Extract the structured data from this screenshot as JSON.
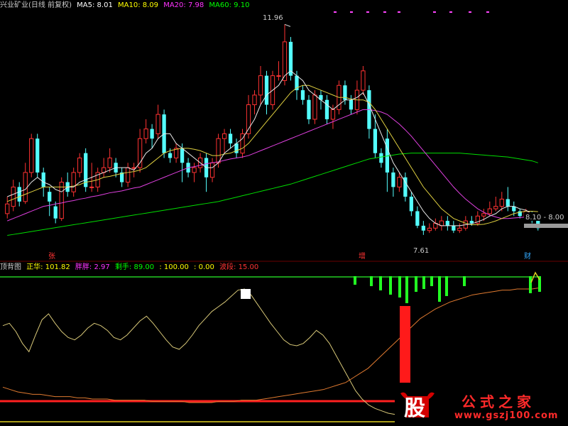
{
  "top_legend": [
    {
      "text": "兴业矿业(日线 前复权)",
      "color": "#cccccc"
    },
    {
      "text": "MA5: 8.01",
      "color": "#ffffff"
    },
    {
      "text": "MA10: 8.09",
      "color": "#ffff00"
    },
    {
      "text": "MA20: 7.98",
      "color": "#ff33ff"
    },
    {
      "text": "MA60: 9.10",
      "color": "#00ff00"
    }
  ],
  "bottom_legend": [
    {
      "text": "顶背图",
      "color": "#cccccc"
    },
    {
      "text": "正华: 101.82",
      "color": "#ffff00"
    },
    {
      "text": "胖胖: 2.97",
      "color": "#ff33ff"
    },
    {
      "text": "剩手: 89.00",
      "color": "#00ff00"
    },
    {
      "text": ": 100.00",
      "color": "#ffff00"
    },
    {
      "text": ": 0.00",
      "color": "#ffff00"
    },
    {
      "text": "波段: 15.00",
      "color": "#ff3333"
    }
  ],
  "watermark": {
    "logo_char": "股",
    "brand": "公式之家",
    "url": "www.gszj100.com"
  },
  "chart_data": [
    {
      "type": "candlestick",
      "title": "兴业矿业(日线 前复权)",
      "ylim": [
        7.3,
        12.2
      ],
      "annotations": {
        "high_label": "11.96",
        "low_label": "7.61",
        "price_tag": "8.10 - 8.00"
      },
      "markers": [
        "张",
        "增",
        "财"
      ],
      "candles": [
        [
          8.05,
          8.25,
          8.4,
          7.95
        ],
        [
          8.2,
          8.6,
          8.75,
          8.1
        ],
        [
          8.6,
          8.3,
          8.7,
          8.2
        ],
        [
          8.3,
          8.9,
          9.1,
          8.25
        ],
        [
          8.9,
          9.6,
          9.7,
          8.8
        ],
        [
          9.6,
          8.9,
          9.7,
          8.8
        ],
        [
          8.9,
          8.6,
          9.0,
          8.4
        ],
        [
          8.5,
          8.3,
          8.6,
          8.0
        ],
        [
          8.2,
          7.95,
          8.3,
          7.85
        ],
        [
          7.95,
          8.7,
          8.8,
          7.9
        ],
        [
          8.7,
          8.5,
          8.9,
          8.4
        ],
        [
          8.5,
          8.9,
          9.0,
          8.4
        ],
        [
          8.9,
          9.2,
          9.3,
          8.8
        ],
        [
          9.3,
          8.6,
          9.4,
          8.5
        ],
        [
          8.6,
          8.6,
          9.1,
          8.5
        ],
        [
          8.6,
          8.9,
          9.0,
          8.5
        ],
        [
          8.9,
          9.0,
          9.2,
          8.8
        ],
        [
          9.0,
          9.2,
          9.4,
          8.9
        ],
        [
          9.1,
          8.9,
          9.2,
          8.8
        ],
        [
          8.9,
          8.7,
          9.0,
          8.6
        ],
        [
          8.7,
          9.0,
          9.1,
          8.6
        ],
        [
          9.0,
          9.0,
          9.1,
          8.8
        ],
        [
          9.0,
          9.6,
          9.8,
          8.9
        ],
        [
          9.6,
          9.8,
          10.0,
          9.5
        ],
        [
          9.8,
          9.6,
          9.9,
          9.4
        ],
        [
          9.7,
          10.1,
          10.3,
          9.6
        ],
        [
          10.1,
          9.3,
          10.2,
          9.2
        ],
        [
          9.3,
          9.2,
          9.4,
          9.1
        ],
        [
          9.2,
          9.4,
          9.5,
          9.1
        ],
        [
          9.4,
          9.1,
          9.5,
          8.7
        ],
        [
          9.1,
          8.9,
          9.2,
          8.8
        ],
        [
          8.9,
          9.0,
          9.1,
          8.7
        ],
        [
          9.0,
          9.2,
          9.3,
          8.9
        ],
        [
          9.2,
          8.8,
          9.3,
          8.5
        ],
        [
          8.8,
          9.1,
          9.2,
          8.7
        ],
        [
          9.1,
          9.6,
          9.7,
          9.0
        ],
        [
          9.6,
          9.7,
          9.8,
          9.3
        ],
        [
          9.7,
          9.5,
          9.8,
          9.4
        ],
        [
          9.5,
          9.3,
          9.6,
          9.2
        ],
        [
          9.3,
          9.7,
          9.8,
          9.2
        ],
        [
          9.7,
          10.3,
          10.5,
          9.6
        ],
        [
          10.3,
          10.5,
          10.6,
          10.1
        ],
        [
          10.5,
          10.9,
          11.1,
          10.3
        ],
        [
          10.9,
          10.3,
          11.0,
          10.1
        ],
        [
          10.3,
          10.9,
          11.0,
          10.2
        ],
        [
          10.9,
          10.9,
          11.2,
          10.8
        ],
        [
          10.8,
          11.6,
          11.96,
          10.7
        ],
        [
          11.6,
          10.9,
          11.7,
          10.8
        ],
        [
          10.9,
          10.6,
          11.0,
          10.4
        ],
        [
          10.6,
          10.4,
          10.7,
          10.3
        ],
        [
          10.4,
          10.0,
          10.5,
          9.9
        ],
        [
          10.0,
          10.5,
          10.6,
          9.9
        ],
        [
          10.5,
          10.4,
          10.6,
          10.2
        ],
        [
          10.4,
          10.0,
          10.5,
          9.9
        ],
        [
          10.0,
          10.2,
          10.3,
          9.8
        ],
        [
          10.2,
          10.7,
          10.8,
          10.1
        ],
        [
          10.7,
          10.4,
          10.8,
          10.3
        ],
        [
          10.4,
          10.2,
          10.5,
          10.1
        ],
        [
          10.2,
          10.6,
          10.8,
          10.1
        ],
        [
          10.6,
          11.0,
          11.1,
          10.5
        ],
        [
          10.6,
          9.8,
          10.7,
          9.6
        ],
        [
          9.8,
          9.3,
          10.1,
          9.2
        ],
        [
          9.3,
          9.1,
          9.4,
          9.0
        ],
        [
          9.6,
          8.9,
          9.8,
          8.5
        ],
        [
          8.9,
          8.6,
          9.0,
          8.4
        ],
        [
          8.6,
          8.8,
          8.9,
          8.5
        ],
        [
          8.8,
          8.4,
          8.9,
          8.3
        ],
        [
          8.4,
          8.1,
          8.5,
          8.0
        ],
        [
          8.1,
          7.8,
          8.2,
          7.75
        ],
        [
          7.8,
          7.7,
          7.9,
          7.61
        ],
        [
          7.7,
          7.75,
          7.85,
          7.65
        ],
        [
          7.75,
          7.85,
          7.95,
          7.7
        ],
        [
          7.8,
          7.9,
          8.0,
          7.7
        ],
        [
          7.9,
          7.8,
          8.0,
          7.7
        ],
        [
          7.8,
          7.7,
          7.9,
          7.65
        ],
        [
          7.7,
          7.75,
          7.85,
          7.65
        ],
        [
          7.75,
          7.9,
          8.0,
          7.7
        ],
        [
          7.9,
          7.85,
          8.0,
          7.8
        ],
        [
          7.85,
          8.0,
          8.1,
          7.8
        ],
        [
          8.0,
          8.05,
          8.15,
          7.9
        ],
        [
          8.05,
          8.15,
          8.3,
          8.0
        ],
        [
          8.15,
          8.2,
          8.4,
          8.1
        ],
        [
          8.2,
          8.35,
          8.5,
          8.1
        ],
        [
          8.35,
          8.2,
          8.6,
          8.1
        ],
        [
          8.2,
          8.1,
          8.3,
          8.0
        ],
        [
          8.1,
          8.0,
          8.15,
          7.95
        ],
        [
          8.0,
          8.1,
          8.15,
          7.95
        ],
        [
          8.05,
          7.9,
          8.1,
          7.85
        ],
        [
          7.9,
          7.75,
          7.95,
          7.7
        ]
      ],
      "ma5": [
        8.4,
        8.45,
        8.5,
        8.55,
        8.7,
        8.8,
        8.7,
        8.65,
        8.55,
        8.5,
        8.6,
        8.6,
        8.7,
        8.75,
        8.8,
        8.85,
        8.9,
        8.95,
        9.0,
        9.0,
        9.0,
        8.95,
        9.1,
        9.3,
        9.4,
        9.6,
        9.7,
        9.7,
        9.5,
        9.4,
        9.3,
        9.2,
        9.1,
        9.0,
        9.0,
        9.1,
        9.3,
        9.4,
        9.5,
        9.6,
        9.8,
        10.0,
        10.3,
        10.5,
        10.6,
        10.7,
        10.9,
        11.0,
        10.9,
        10.8,
        10.6,
        10.5,
        10.4,
        10.3,
        10.2,
        10.3,
        10.4,
        10.4,
        10.45,
        10.55,
        10.3,
        10.0,
        9.7,
        9.4,
        9.1,
        8.9,
        8.7,
        8.5,
        8.3,
        8.1,
        7.95,
        7.85,
        7.8,
        7.8,
        7.8,
        7.8,
        7.82,
        7.84,
        7.88,
        7.93,
        8.0,
        8.05,
        8.15,
        8.2,
        8.2,
        8.15,
        8.12,
        8.05,
        8.0
      ],
      "ma10": [
        8.3,
        8.35,
        8.4,
        8.45,
        8.5,
        8.55,
        8.6,
        8.6,
        8.6,
        8.6,
        8.6,
        8.62,
        8.65,
        8.7,
        8.72,
        8.75,
        8.8,
        8.82,
        8.85,
        8.88,
        8.9,
        8.92,
        8.95,
        9.0,
        9.1,
        9.2,
        9.3,
        9.35,
        9.38,
        9.4,
        9.4,
        9.38,
        9.35,
        9.3,
        9.25,
        9.25,
        9.28,
        9.3,
        9.35,
        9.4,
        9.5,
        9.65,
        9.8,
        9.95,
        10.1,
        10.25,
        10.4,
        10.55,
        10.65,
        10.7,
        10.7,
        10.65,
        10.6,
        10.55,
        10.5,
        10.45,
        10.45,
        10.42,
        10.4,
        10.4,
        10.35,
        10.2,
        10.0,
        9.8,
        9.6,
        9.4,
        9.2,
        9.0,
        8.8,
        8.6,
        8.45,
        8.3,
        8.15,
        8.05,
        7.95,
        7.9,
        7.85,
        7.82,
        7.82,
        7.83,
        7.86,
        7.9,
        7.95,
        8.0,
        8.05,
        8.08,
        8.1,
        8.1,
        8.09
      ],
      "ma20": [
        7.9,
        7.95,
        8.0,
        8.05,
        8.1,
        8.15,
        8.2,
        8.22,
        8.25,
        8.27,
        8.3,
        8.32,
        8.35,
        8.37,
        8.4,
        8.42,
        8.45,
        8.48,
        8.5,
        8.52,
        8.55,
        8.58,
        8.6,
        8.65,
        8.7,
        8.75,
        8.8,
        8.85,
        8.9,
        8.95,
        9.0,
        9.02,
        9.05,
        9.08,
        9.1,
        9.12,
        9.15,
        9.18,
        9.2,
        9.22,
        9.25,
        9.3,
        9.35,
        9.4,
        9.45,
        9.5,
        9.55,
        9.6,
        9.65,
        9.7,
        9.75,
        9.8,
        9.85,
        9.9,
        9.95,
        10.0,
        10.05,
        10.1,
        10.15,
        10.2,
        10.2,
        10.18,
        10.15,
        10.1,
        10.0,
        9.9,
        9.78,
        9.65,
        9.5,
        9.35,
        9.2,
        9.05,
        8.9,
        8.75,
        8.6,
        8.47,
        8.35,
        8.25,
        8.15,
        8.08,
        8.02,
        7.98,
        7.95,
        7.95,
        7.96,
        7.97,
        7.98,
        7.98,
        7.98
      ],
      "ma60": [
        7.6,
        7.62,
        7.64,
        7.66,
        7.68,
        7.7,
        7.72,
        7.74,
        7.76,
        7.78,
        7.8,
        7.82,
        7.84,
        7.86,
        7.88,
        7.9,
        7.92,
        7.94,
        7.96,
        7.98,
        8.0,
        8.02,
        8.04,
        8.06,
        8.08,
        8.1,
        8.12,
        8.14,
        8.16,
        8.18,
        8.2,
        8.22,
        8.24,
        8.26,
        8.28,
        8.3,
        8.33,
        8.36,
        8.39,
        8.42,
        8.45,
        8.48,
        8.51,
        8.54,
        8.57,
        8.6,
        8.63,
        8.66,
        8.7,
        8.74,
        8.78,
        8.82,
        8.86,
        8.9,
        8.94,
        8.98,
        9.02,
        9.06,
        9.1,
        9.14,
        9.18,
        9.2,
        9.22,
        9.24,
        9.26,
        9.28,
        9.29,
        9.3,
        9.3,
        9.3,
        9.3,
        9.3,
        9.3,
        9.3,
        9.3,
        9.3,
        9.29,
        9.28,
        9.27,
        9.26,
        9.25,
        9.24,
        9.23,
        9.22,
        9.2,
        9.18,
        9.16,
        9.14,
        9.1
      ]
    },
    {
      "type": "line",
      "title": "顶背图",
      "ylim": [
        -10,
        110
      ],
      "series": [
        {
          "name": "正华",
          "color": "#ffff00",
          "values": [
            70,
            72,
            65,
            55,
            48,
            62,
            75,
            80,
            72,
            65,
            60,
            58,
            62,
            68,
            72,
            70,
            66,
            60,
            58,
            62,
            68,
            74,
            78,
            72,
            65,
            58,
            52,
            50,
            55,
            62,
            70,
            76,
            82,
            86,
            90,
            95,
            100,
            101,
            96,
            88,
            80,
            72,
            65,
            58,
            54,
            53,
            55,
            60,
            66,
            62,
            55,
            45,
            35,
            25,
            15,
            8,
            3,
            0,
            -2,
            -4,
            -5
          ]
        },
        {
          "name": "胖胖",
          "color": "#ff8800",
          "values": [
            18,
            16,
            14,
            13,
            12,
            12,
            11,
            10,
            10,
            10,
            9,
            9,
            8,
            8,
            8,
            7,
            7,
            7,
            7,
            7,
            6,
            6,
            6,
            6,
            6,
            5,
            5,
            5,
            5,
            6,
            6,
            6,
            7,
            7,
            7,
            8,
            9,
            10,
            11,
            12,
            13,
            14,
            15,
            16,
            18,
            20,
            22,
            26,
            30,
            34,
            40,
            46,
            52,
            58,
            64,
            70,
            76,
            80,
            84,
            87,
            90,
            92,
            94,
            96,
            97,
            98,
            99,
            100,
            100,
            101,
            101,
            101,
            102
          ]
        }
      ],
      "bars_green": [
        0,
        0,
        0,
        0,
        0,
        0,
        0,
        0,
        0,
        0,
        0,
        0,
        0,
        0,
        0,
        0,
        0,
        0,
        0,
        0,
        0,
        0,
        0,
        0,
        0,
        0,
        0,
        0,
        0,
        0,
        0,
        0,
        0,
        0,
        0,
        0,
        0,
        0,
        0,
        0,
        0,
        0,
        0,
        0,
        0,
        0,
        0,
        0,
        0,
        0,
        0,
        0,
        0,
        0,
        0,
        0,
        0,
        0,
        0,
        0,
        0,
        0,
        0,
        0,
        0,
        0,
        0,
        0,
        0,
        0,
        0,
        0,
        0,
        0,
        0,
        0,
        0,
        0,
        0,
        0,
        0,
        0,
        0,
        0,
        0,
        0,
        0,
        0,
        0
      ],
      "bars_red_value": 85
    }
  ]
}
